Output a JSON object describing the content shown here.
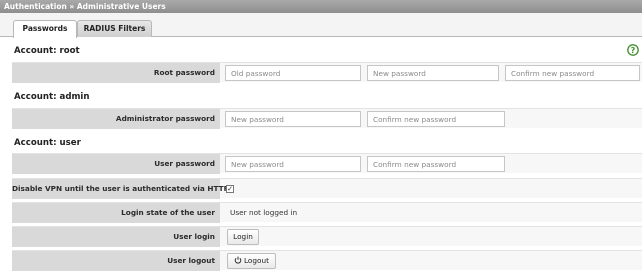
{
  "window": {
    "title": "Authentication » Administrative Users"
  },
  "tabs": [
    {
      "label": "Passwords",
      "active": true
    },
    {
      "label": "RADIUS Filters",
      "active": false
    }
  ],
  "help_icon": {
    "icon": "help-icon",
    "glyph": "?",
    "color": "#3f8f2e"
  },
  "root": {
    "title": "Account: root",
    "password_label": "Root password",
    "old_placeholder": "Old password",
    "new_placeholder": "New password",
    "confirm_placeholder": "Confirm new password"
  },
  "admin": {
    "title": "Account: admin",
    "password_label": "Administrator password",
    "new_placeholder": "New password",
    "confirm_placeholder": "Confirm new password"
  },
  "user": {
    "title": "Account: user",
    "password_label": "User password",
    "new_placeholder": "New password",
    "confirm_placeholder": "Confirm new password",
    "vpn_label": "Disable VPN until the user is authenticated via HTTP",
    "vpn_checked": true,
    "vpn_check_glyph": "✓",
    "login_state_label": "Login state of the user",
    "login_state_value": "User not logged in",
    "login_label": "User login",
    "login_button": "Login",
    "logout_label": "User logout",
    "logout_button": "Logout",
    "logout_icon": "power-icon"
  }
}
